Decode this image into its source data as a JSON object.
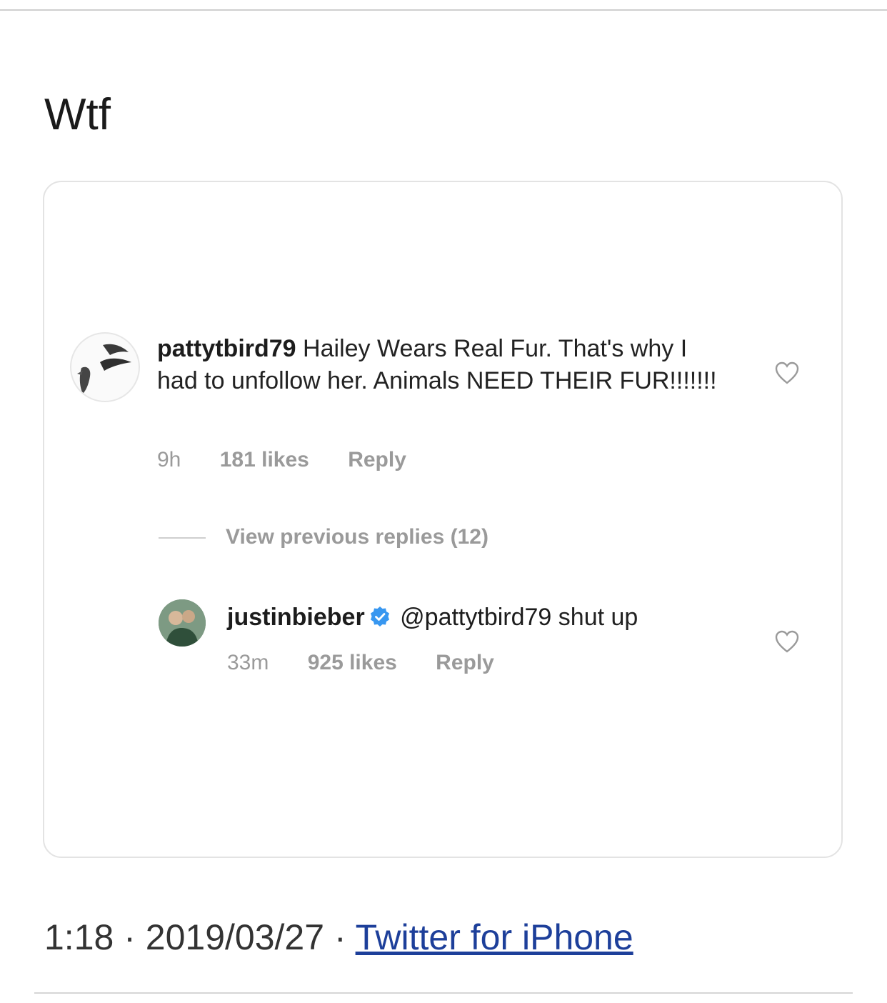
{
  "tweet": {
    "text": "Wtf",
    "time": "1:18",
    "date": "2019/03/27",
    "separator": "·",
    "source": "Twitter for iPhone"
  },
  "embedded_screenshot": {
    "comment": {
      "username": "pattytbird79",
      "text": "Hailey Wears Real Fur. That's why I had to unfollow her. Animals NEED THEIR FUR!!!!!!!",
      "age": "9h",
      "likes": "181 likes",
      "reply_label": "Reply"
    },
    "view_replies_label": "View previous replies (12)",
    "reply": {
      "username": "justinbieber",
      "mention": "@pattytbird79",
      "text": "shut up",
      "age": "33m",
      "likes": "925 likes",
      "reply_label": "Reply"
    },
    "colors": {
      "verified_badge": "#3897f0",
      "meta_text": "#9a9a9a",
      "link": "#1d3f9a"
    },
    "icons": [
      "heart-outline-icon",
      "verified-badge-icon"
    ]
  }
}
